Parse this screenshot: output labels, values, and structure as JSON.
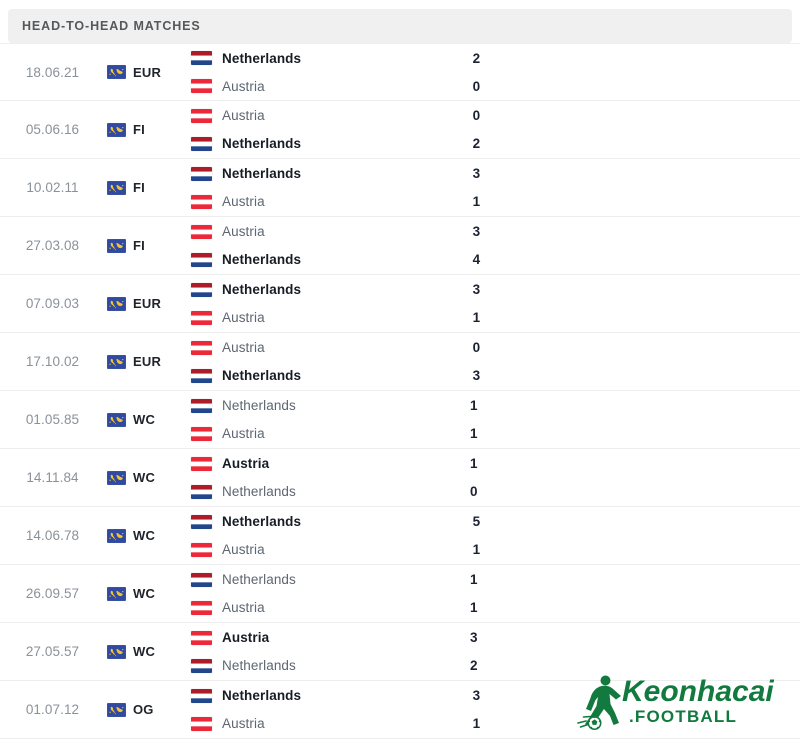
{
  "header": {
    "title": "HEAD-TO-HEAD MATCHES"
  },
  "colors": {
    "header_bg": "#f0f0f0",
    "header_text": "#55595c",
    "date_text": "#8a9199",
    "team_text": "#5d6672",
    "winner_text": "#171c25",
    "score_text": "#1c2230",
    "divider": "#ededed",
    "comp_icon_bg": "#2f4aa0",
    "comp_icon_fg": "#efc33c",
    "flag_nl_red": "#ae1c28",
    "flag_nl_white": "#ffffff",
    "flag_nl_blue": "#21468b",
    "flag_at_red": "#ed2939",
    "flag_at_white": "#ffffff",
    "logo_green": "#127a3e"
  },
  "icons": {
    "competition": "globe-icon",
    "flag_netherlands": "flag-netherlands-icon",
    "flag_austria": "flag-austria-icon",
    "watermark": "keonhacai-football-logo"
  },
  "watermark": {
    "brand": "Keonhacai",
    "suffix": ".FOOTBALL"
  },
  "matches": [
    {
      "date": "18.06.21",
      "competition": "EUR",
      "home": {
        "team": "Netherlands",
        "flag": "netherlands",
        "score": "2",
        "winner": true
      },
      "away": {
        "team": "Austria",
        "flag": "austria",
        "score": "0",
        "winner": false
      }
    },
    {
      "date": "05.06.16",
      "competition": "FI",
      "home": {
        "team": "Austria",
        "flag": "austria",
        "score": "0",
        "winner": false
      },
      "away": {
        "team": "Netherlands",
        "flag": "netherlands",
        "score": "2",
        "winner": true
      }
    },
    {
      "date": "10.02.11",
      "competition": "FI",
      "home": {
        "team": "Netherlands",
        "flag": "netherlands",
        "score": "3",
        "winner": true
      },
      "away": {
        "team": "Austria",
        "flag": "austria",
        "score": "1",
        "winner": false
      }
    },
    {
      "date": "27.03.08",
      "competition": "FI",
      "home": {
        "team": "Austria",
        "flag": "austria",
        "score": "3",
        "winner": false
      },
      "away": {
        "team": "Netherlands",
        "flag": "netherlands",
        "score": "4",
        "winner": true
      }
    },
    {
      "date": "07.09.03",
      "competition": "EUR",
      "home": {
        "team": "Netherlands",
        "flag": "netherlands",
        "score": "3",
        "winner": true
      },
      "away": {
        "team": "Austria",
        "flag": "austria",
        "score": "1",
        "winner": false
      }
    },
    {
      "date": "17.10.02",
      "competition": "EUR",
      "home": {
        "team": "Austria",
        "flag": "austria",
        "score": "0",
        "winner": false
      },
      "away": {
        "team": "Netherlands",
        "flag": "netherlands",
        "score": "3",
        "winner": true
      }
    },
    {
      "date": "01.05.85",
      "competition": "WC",
      "home": {
        "team": "Netherlands",
        "flag": "netherlands",
        "score": "1",
        "winner": false
      },
      "away": {
        "team": "Austria",
        "flag": "austria",
        "score": "1",
        "winner": false
      }
    },
    {
      "date": "14.11.84",
      "competition": "WC",
      "home": {
        "team": "Austria",
        "flag": "austria",
        "score": "1",
        "winner": true
      },
      "away": {
        "team": "Netherlands",
        "flag": "netherlands",
        "score": "0",
        "winner": false
      }
    },
    {
      "date": "14.06.78",
      "competition": "WC",
      "home": {
        "team": "Netherlands",
        "flag": "netherlands",
        "score": "5",
        "winner": true
      },
      "away": {
        "team": "Austria",
        "flag": "austria",
        "score": "1",
        "winner": false
      }
    },
    {
      "date": "26.09.57",
      "competition": "WC",
      "home": {
        "team": "Netherlands",
        "flag": "netherlands",
        "score": "1",
        "winner": false
      },
      "away": {
        "team": "Austria",
        "flag": "austria",
        "score": "1",
        "winner": false
      }
    },
    {
      "date": "27.05.57",
      "competition": "WC",
      "home": {
        "team": "Austria",
        "flag": "austria",
        "score": "3",
        "winner": true
      },
      "away": {
        "team": "Netherlands",
        "flag": "netherlands",
        "score": "2",
        "winner": false
      }
    },
    {
      "date": "01.07.12",
      "competition": "OG",
      "home": {
        "team": "Netherlands",
        "flag": "netherlands",
        "score": "3",
        "winner": true
      },
      "away": {
        "team": "Austria",
        "flag": "austria",
        "score": "1",
        "winner": false
      }
    }
  ]
}
